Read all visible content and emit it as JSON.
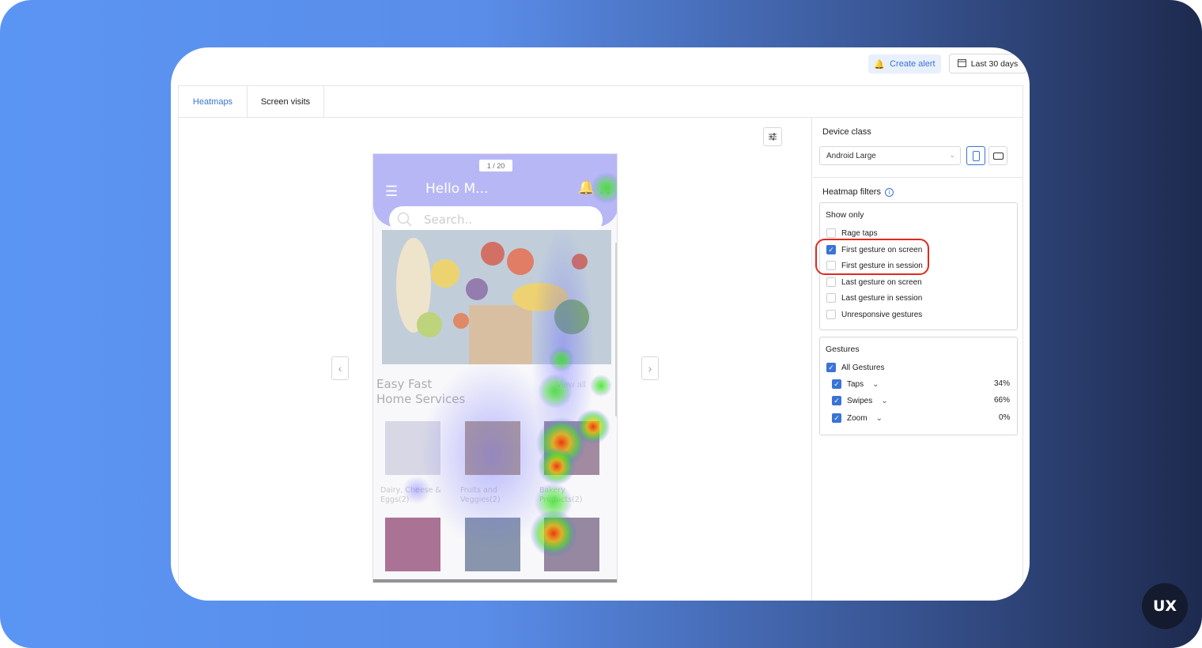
{
  "toolbar": {
    "create_alert_label": "Create alert",
    "date_range_label": "Last 30 days"
  },
  "tabs": [
    {
      "label": "Heatmaps",
      "active": true
    },
    {
      "label": "Screen visits",
      "active": false
    }
  ],
  "viewer": {
    "screen_counter": "1 / 20",
    "phone": {
      "greeting": "Hello M...",
      "search_placeholder": "Search..",
      "section_title_line1": "Easy Fast",
      "section_title_line2": "Home Services",
      "view_all": "View all",
      "products": [
        {
          "label_line1": "Dairy, Cheese &",
          "label_line2": "Eggs(2)"
        },
        {
          "label_line1": "Fruits and",
          "label_line2": "Veggies(2)"
        },
        {
          "label_line1": "Bakery",
          "label_line2": "Products(2)"
        }
      ]
    }
  },
  "sidebar": {
    "device_class_label": "Device class",
    "device_class_value": "Android Large",
    "heatmap_filters_label": "Heatmap filters",
    "show_only_label": "Show only",
    "show_only_options": [
      {
        "label": "Rage taps",
        "checked": false
      },
      {
        "label": "First gesture on screen",
        "checked": true
      },
      {
        "label": "First gesture in session",
        "checked": false
      },
      {
        "label": "Last gesture on screen",
        "checked": false
      },
      {
        "label": "Last gesture in session",
        "checked": false
      },
      {
        "label": "Unresponsive gestures",
        "checked": false
      }
    ],
    "gestures_label": "Gestures",
    "all_gestures_label": "All Gestures",
    "gestures": [
      {
        "label": "Taps",
        "percent": "34%",
        "checked": true
      },
      {
        "label": "Swipes",
        "percent": "66%",
        "checked": true
      },
      {
        "label": "Zoom",
        "percent": "0%",
        "checked": true
      }
    ]
  },
  "brand_badge": "UX",
  "colors": {
    "accent": "#3a73d6",
    "highlight": "#e0281f",
    "phone_header": "#9c9bf3"
  }
}
